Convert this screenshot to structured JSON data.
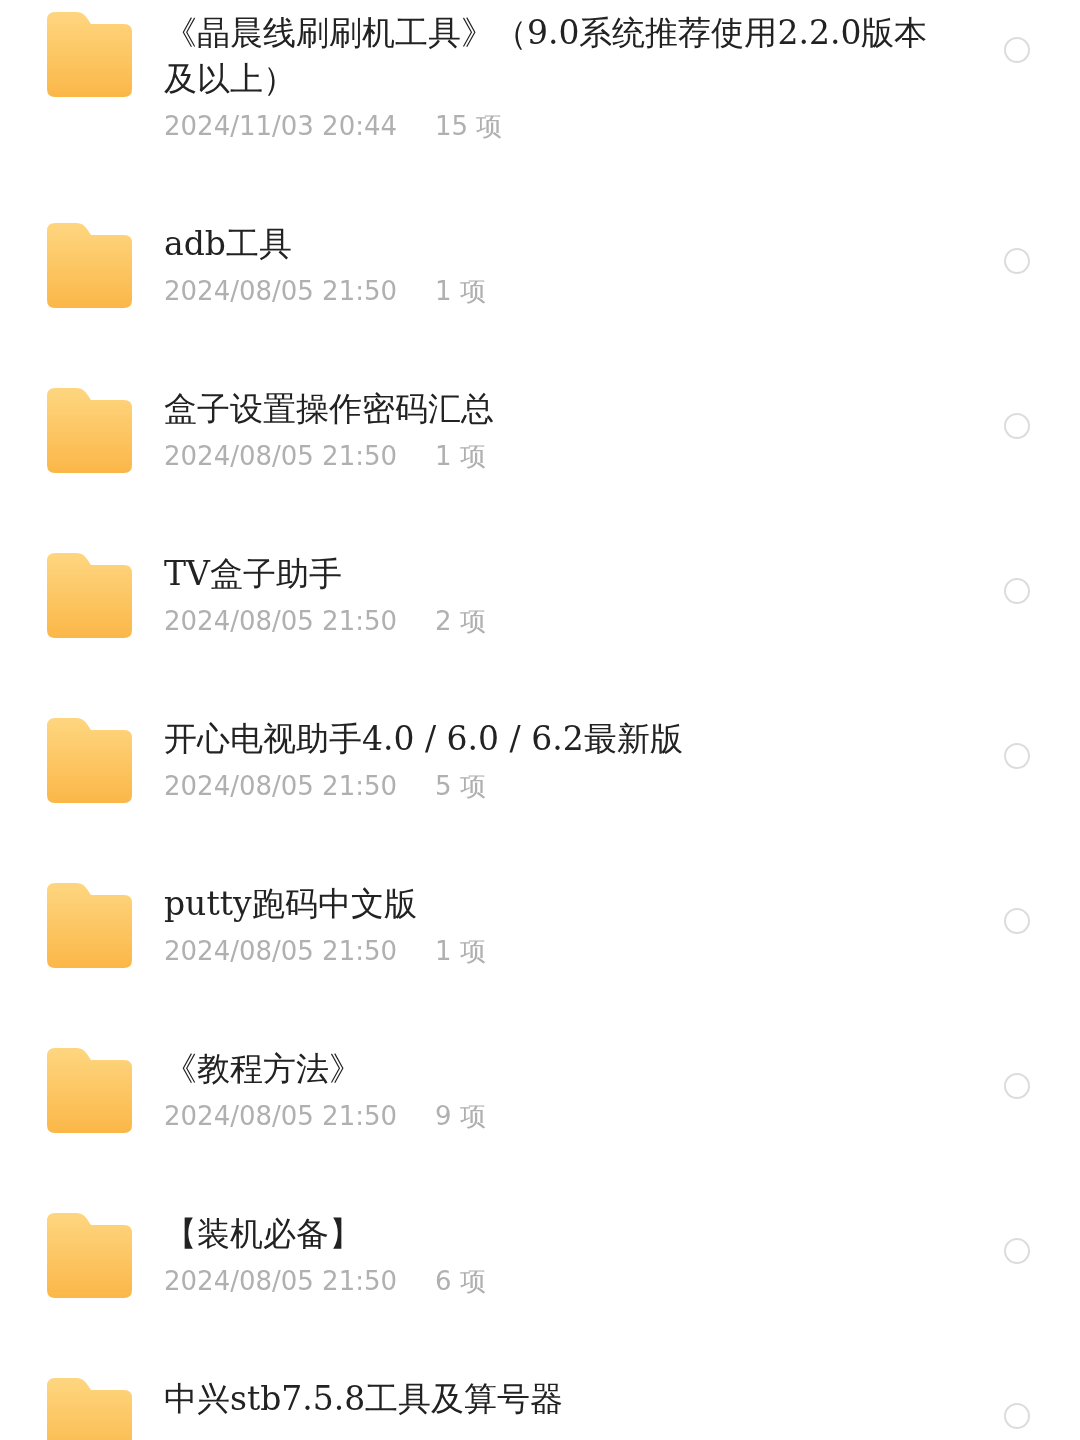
{
  "items": [
    {
      "name": "《晶晨线刷刷机工具》（9.0系统推荐使用2.2.0版本及以上）",
      "date": "2024/11/03 20:44",
      "count": "15 项",
      "selected": false
    },
    {
      "name": "adb工具",
      "date": "2024/08/05 21:50",
      "count": "1 项",
      "selected": false
    },
    {
      "name": "盒子设置操作密码汇总",
      "date": "2024/08/05 21:50",
      "count": "1 项",
      "selected": false
    },
    {
      "name": "TV盒子助手",
      "date": "2024/08/05 21:50",
      "count": "2 项",
      "selected": false
    },
    {
      "name": "开心电视助手4.0 / 6.0 / 6.2最新版",
      "date": "2024/08/05 21:50",
      "count": "5 项",
      "selected": false
    },
    {
      "name": "putty跑码中文版",
      "date": "2024/08/05 21:50",
      "count": "1 项",
      "selected": false
    },
    {
      "name": "《教程方法》",
      "date": "2024/08/05 21:50",
      "count": "9 项",
      "selected": false
    },
    {
      "name": "【装机必备】",
      "date": "2024/08/05 21:50",
      "count": "6 项",
      "selected": false
    },
    {
      "name": "中兴stb7.5.8工具及算号器",
      "selected": false
    }
  ]
}
